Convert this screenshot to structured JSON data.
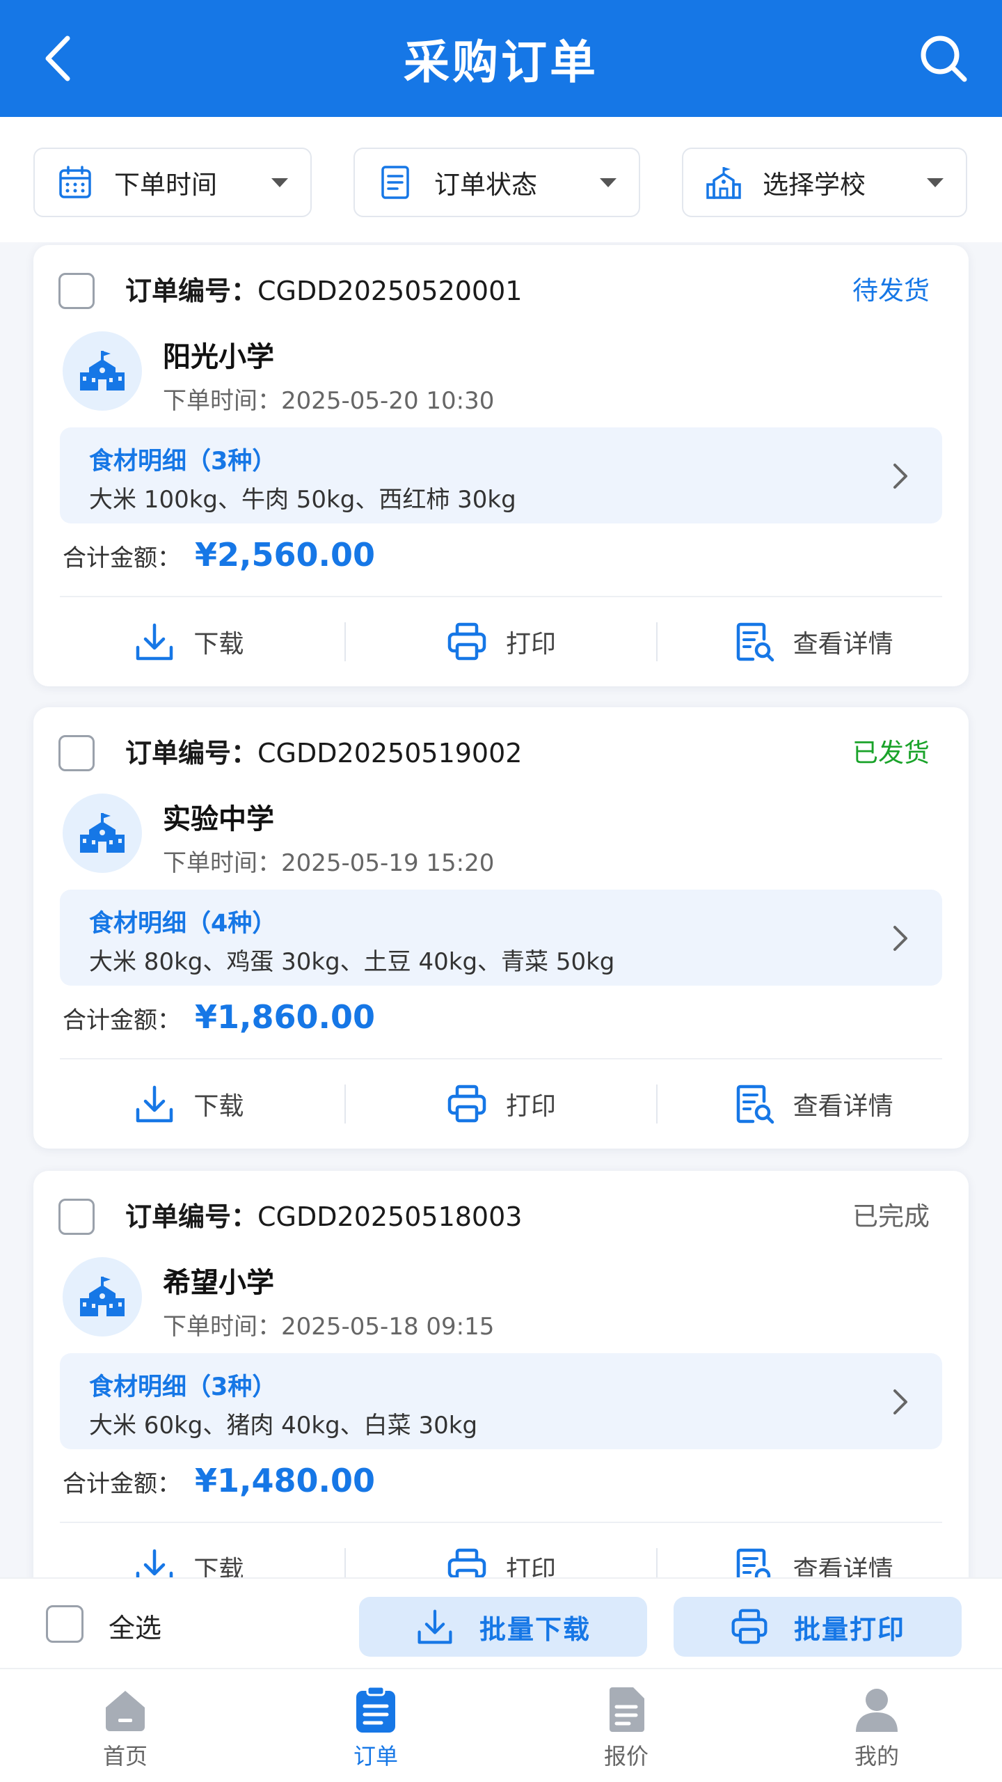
{
  "header": {
    "title": "采购订单",
    "back_icon": "back-arrow-icon",
    "search_icon": "search-icon"
  },
  "filters": [
    {
      "label": "下单时间",
      "icon": "calendar-icon"
    },
    {
      "label": "订单状态",
      "icon": "document-icon"
    },
    {
      "label": "选择学校",
      "icon": "school-icon"
    }
  ],
  "orders": [
    {
      "order_label": "订单编号：",
      "order_no": "CGDD20250520001",
      "status": "待发货",
      "status_color": "#1677e6",
      "school": "阳光小学",
      "time_label": "下单时间：",
      "time": "2025-05-20 10:30",
      "items_header": "食材明细（3种）",
      "items": "大米 100kg、牛肉 50kg、西红柿 30kg",
      "total_label": "合计金额：",
      "total": "¥2,560.00"
    },
    {
      "order_label": "订单编号：",
      "order_no": "CGDD20250519002",
      "status": "已发货",
      "status_color": "#1aa32a",
      "school": "实验中学",
      "time_label": "下单时间：",
      "time": "2025-05-19 15:20",
      "items_header": "食材明细（4种）",
      "items": "大米 80kg、鸡蛋 30kg、土豆 40kg、青菜 50kg",
      "total_label": "合计金额：",
      "total": "¥1,860.00"
    },
    {
      "order_label": "订单编号：",
      "order_no": "CGDD20250518003",
      "status": "已完成",
      "status_color": "#666666",
      "school": "希望小学",
      "time_label": "下单时间：",
      "time": "2025-05-18 09:15",
      "items_header": "食材明细（3种）",
      "items": "大米 60kg、猪肉 40kg、白菜 30kg",
      "total_label": "合计金额：",
      "total": "¥1,480.00"
    }
  ],
  "actions": {
    "download": "下载",
    "print": "打印",
    "detail": "查看详情"
  },
  "batch": {
    "select_all": "全选",
    "download": "批量下载",
    "print": "批量打印"
  },
  "tabs": [
    {
      "label": "首页",
      "icon": "home-icon",
      "active": false
    },
    {
      "label": "订单",
      "icon": "order-clipboard-icon",
      "active": true
    },
    {
      "label": "报价",
      "icon": "quote-document-icon",
      "active": false
    },
    {
      "label": "我的",
      "icon": "user-icon",
      "active": false
    }
  ],
  "colors": {
    "primary": "#1677e6",
    "shipped": "#1aa32a",
    "completed": "#666666"
  }
}
